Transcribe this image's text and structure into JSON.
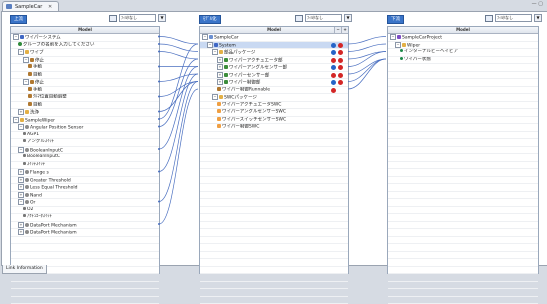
{
  "window": {
    "tab_title": "SampleCar",
    "tab_close": "✕",
    "controls": "— ▢"
  },
  "left": {
    "badge": "上流",
    "filter": "ﾌｨﾙﾀなし",
    "header": "Model",
    "rows": [
      {
        "d": 0,
        "e": "−",
        "i": "sys",
        "t": "ワイパーシステム"
      },
      {
        "d": 1,
        "e": "",
        "i": "grp",
        "t": "グループの名前を入力してください"
      },
      {
        "d": 1,
        "e": "−",
        "i": "fld",
        "t": "ワイプ"
      },
      {
        "d": 2,
        "e": "−",
        "i": "doc",
        "t": "停止"
      },
      {
        "d": 3,
        "e": "",
        "i": "doc",
        "t": "手動"
      },
      {
        "d": 3,
        "e": "",
        "i": "doc",
        "t": "自動"
      },
      {
        "d": 2,
        "e": "−",
        "i": "doc",
        "t": "停止"
      },
      {
        "d": 3,
        "e": "",
        "i": "doc",
        "t": "手動"
      },
      {
        "d": 3,
        "e": "",
        "i": "doc",
        "t": "ｸﾙﾏ位置自動調整"
      },
      {
        "d": 3,
        "e": "",
        "i": "doc",
        "t": "自動"
      },
      {
        "d": 1,
        "e": "+",
        "i": "fld",
        "t": "洗浄"
      },
      {
        "d": 0,
        "e": "−",
        "i": "fld",
        "t": "SampleWiper"
      },
      {
        "d": 1,
        "e": "−",
        "i": "req",
        "t": "Angular Position Sensor"
      },
      {
        "d": 2,
        "e": "",
        "i": "pen",
        "t": "AGP1"
      },
      {
        "d": 2,
        "e": "",
        "i": "pen",
        "t": "アングルｽｲｯﾁ"
      },
      {
        "d": 1,
        "e": "−",
        "i": "req",
        "t": "BooleanInputC"
      },
      {
        "d": 2,
        "e": "",
        "i": "pen",
        "t": "BooleanInputC"
      },
      {
        "d": 2,
        "e": "",
        "i": "pen",
        "t": "ｽｲｯﾁｽｲｯﾁ"
      },
      {
        "d": 1,
        "e": "+",
        "i": "req",
        "t": "Flange s"
      },
      {
        "d": 1,
        "e": "+",
        "i": "req",
        "t": "Greater Threshold"
      },
      {
        "d": 1,
        "e": "+",
        "i": "req",
        "t": "Less Equal Threshold"
      },
      {
        "d": 1,
        "e": "+",
        "i": "req",
        "t": "Nand"
      },
      {
        "d": 1,
        "e": "−",
        "i": "req",
        "t": "Or"
      },
      {
        "d": 2,
        "e": "",
        "i": "pen",
        "t": "O2"
      },
      {
        "d": 2,
        "e": "",
        "i": "pen",
        "t": "ｱｸﾁｭｴｰﾀｽｲｯﾁ"
      },
      {
        "d": 1,
        "e": "+",
        "i": "req",
        "t": "DataPort Mechanism"
      },
      {
        "d": 1,
        "e": "+",
        "i": "req",
        "t": "DataPort Mechanism"
      },
      {
        "d": 0,
        "e": "",
        "i": "",
        "t": ""
      },
      {
        "d": 0,
        "e": "",
        "i": "",
        "t": ""
      },
      {
        "d": 0,
        "e": "",
        "i": "",
        "t": ""
      },
      {
        "d": 0,
        "e": "",
        "i": "",
        "t": ""
      },
      {
        "d": 0,
        "e": "",
        "i": "",
        "t": ""
      },
      {
        "d": 0,
        "e": "",
        "i": "",
        "t": ""
      },
      {
        "d": 0,
        "e": "",
        "i": "",
        "t": ""
      },
      {
        "d": 0,
        "e": "",
        "i": "",
        "t": ""
      },
      {
        "d": 0,
        "e": "",
        "i": "",
        "t": ""
      }
    ]
  },
  "middle": {
    "badge": "ﾓﾃﾞﾙ化",
    "filter": "ﾌｨﾙﾀなし",
    "header": "Model",
    "header_buttons": [
      "−",
      "+"
    ],
    "rows": [
      {
        "d": 0,
        "e": "−",
        "i": "cmp",
        "t": "SampleCar",
        "m": []
      },
      {
        "d": 1,
        "e": "−",
        "i": "sys",
        "t": "System",
        "m": [
          "b",
          "r"
        ],
        "sel": true
      },
      {
        "d": 2,
        "e": "−",
        "i": "fld",
        "t": "部品パッケージ",
        "m": [
          "b",
          "r"
        ]
      },
      {
        "d": 3,
        "e": "+",
        "i": "gr2",
        "t": "ワイパーアクチュエータ部",
        "m": [
          "r",
          "r"
        ]
      },
      {
        "d": 3,
        "e": "+",
        "i": "gr2",
        "t": "ワイパーアングルセンサー部",
        "m": [
          "b",
          "r"
        ]
      },
      {
        "d": 3,
        "e": "+",
        "i": "gr2",
        "t": "ワイパーセンサー部",
        "m": [
          "r",
          "r"
        ]
      },
      {
        "d": 3,
        "e": "+",
        "i": "gr2",
        "t": "ワイパー制御部",
        "m": [
          "b",
          "r"
        ]
      },
      {
        "d": 3,
        "e": "",
        "i": "doc",
        "t": "ワイパー制御Runnable",
        "m": [
          "r"
        ]
      },
      {
        "d": 2,
        "e": "−",
        "i": "fld",
        "t": "SWCパッケージ",
        "m": []
      },
      {
        "d": 3,
        "e": "",
        "i": "mod",
        "t": "ワイパーアクチュエータSWC",
        "m": []
      },
      {
        "d": 3,
        "e": "",
        "i": "mod",
        "t": "ワイパーアングルセンサーSWC",
        "m": []
      },
      {
        "d": 3,
        "e": "",
        "i": "mod",
        "t": "ワイパースイッチセンサーSWC",
        "m": []
      },
      {
        "d": 3,
        "e": "",
        "i": "mod",
        "t": "ワイパー制御SWC",
        "m": []
      },
      {
        "d": 0,
        "e": "",
        "i": "",
        "t": "",
        "m": []
      },
      {
        "d": 0,
        "e": "",
        "i": "",
        "t": "",
        "m": []
      },
      {
        "d": 0,
        "e": "",
        "i": "",
        "t": "",
        "m": []
      },
      {
        "d": 0,
        "e": "",
        "i": "",
        "t": "",
        "m": []
      },
      {
        "d": 0,
        "e": "",
        "i": "",
        "t": "",
        "m": []
      },
      {
        "d": 0,
        "e": "",
        "i": "",
        "t": "",
        "m": []
      },
      {
        "d": 0,
        "e": "",
        "i": "",
        "t": "",
        "m": []
      },
      {
        "d": 0,
        "e": "",
        "i": "",
        "t": "",
        "m": []
      },
      {
        "d": 0,
        "e": "",
        "i": "",
        "t": "",
        "m": []
      },
      {
        "d": 0,
        "e": "",
        "i": "",
        "t": "",
        "m": []
      },
      {
        "d": 0,
        "e": "",
        "i": "",
        "t": "",
        "m": []
      },
      {
        "d": 0,
        "e": "",
        "i": "",
        "t": "",
        "m": []
      },
      {
        "d": 0,
        "e": "",
        "i": "",
        "t": "",
        "m": []
      },
      {
        "d": 0,
        "e": "",
        "i": "",
        "t": "",
        "m": []
      },
      {
        "d": 0,
        "e": "",
        "i": "",
        "t": "",
        "m": []
      },
      {
        "d": 0,
        "e": "",
        "i": "",
        "t": "",
        "m": []
      },
      {
        "d": 0,
        "e": "",
        "i": "",
        "t": "",
        "m": []
      },
      {
        "d": 0,
        "e": "",
        "i": "",
        "t": "",
        "m": []
      },
      {
        "d": 0,
        "e": "",
        "i": "",
        "t": "",
        "m": []
      },
      {
        "d": 0,
        "e": "",
        "i": "",
        "t": "",
        "m": []
      },
      {
        "d": 0,
        "e": "",
        "i": "",
        "t": "",
        "m": []
      },
      {
        "d": 0,
        "e": "",
        "i": "",
        "t": "",
        "m": []
      },
      {
        "d": 0,
        "e": "",
        "i": "",
        "t": "",
        "m": []
      }
    ]
  },
  "right": {
    "badge": "下流",
    "filter": "ﾌｨﾙﾀなし",
    "header": "Model",
    "rows": [
      {
        "d": 0,
        "e": "−",
        "i": "prj",
        "t": "SampleCarProject"
      },
      {
        "d": 1,
        "e": "−",
        "i": "fld",
        "t": "Wiper"
      },
      {
        "d": 2,
        "e": "",
        "i": "dot",
        "t": "インターナルビーヘイビア"
      },
      {
        "d": 2,
        "e": "",
        "i": "dot",
        "t": "ワイパー状態"
      },
      {
        "d": 0,
        "e": "",
        "i": "",
        "t": ""
      },
      {
        "d": 0,
        "e": "",
        "i": "",
        "t": ""
      },
      {
        "d": 0,
        "e": "",
        "i": "",
        "t": ""
      },
      {
        "d": 0,
        "e": "",
        "i": "",
        "t": ""
      },
      {
        "d": 0,
        "e": "",
        "i": "",
        "t": ""
      },
      {
        "d": 0,
        "e": "",
        "i": "",
        "t": ""
      },
      {
        "d": 0,
        "e": "",
        "i": "",
        "t": ""
      },
      {
        "d": 0,
        "e": "",
        "i": "",
        "t": ""
      },
      {
        "d": 0,
        "e": "",
        "i": "",
        "t": ""
      },
      {
        "d": 0,
        "e": "",
        "i": "",
        "t": ""
      },
      {
        "d": 0,
        "e": "",
        "i": "",
        "t": ""
      },
      {
        "d": 0,
        "e": "",
        "i": "",
        "t": ""
      },
      {
        "d": 0,
        "e": "",
        "i": "",
        "t": ""
      },
      {
        "d": 0,
        "e": "",
        "i": "",
        "t": ""
      },
      {
        "d": 0,
        "e": "",
        "i": "",
        "t": ""
      },
      {
        "d": 0,
        "e": "",
        "i": "",
        "t": ""
      },
      {
        "d": 0,
        "e": "",
        "i": "",
        "t": ""
      },
      {
        "d": 0,
        "e": "",
        "i": "",
        "t": ""
      },
      {
        "d": 0,
        "e": "",
        "i": "",
        "t": ""
      },
      {
        "d": 0,
        "e": "",
        "i": "",
        "t": ""
      },
      {
        "d": 0,
        "e": "",
        "i": "",
        "t": ""
      },
      {
        "d": 0,
        "e": "",
        "i": "",
        "t": ""
      },
      {
        "d": 0,
        "e": "",
        "i": "",
        "t": ""
      },
      {
        "d": 0,
        "e": "",
        "i": "",
        "t": ""
      },
      {
        "d": 0,
        "e": "",
        "i": "",
        "t": ""
      },
      {
        "d": 0,
        "e": "",
        "i": "",
        "t": ""
      },
      {
        "d": 0,
        "e": "",
        "i": "",
        "t": ""
      },
      {
        "d": 0,
        "e": "",
        "i": "",
        "t": ""
      },
      {
        "d": 0,
        "e": "",
        "i": "",
        "t": ""
      },
      {
        "d": 0,
        "e": "",
        "i": "",
        "t": ""
      },
      {
        "d": 0,
        "e": "",
        "i": "",
        "t": ""
      },
      {
        "d": 0,
        "e": "",
        "i": "",
        "t": ""
      }
    ]
  },
  "bottom_tab": "Link Information",
  "colors": {
    "link_line": "#4a6fc0",
    "badge": "#3a74c8",
    "selection": "#c9d9f2"
  }
}
